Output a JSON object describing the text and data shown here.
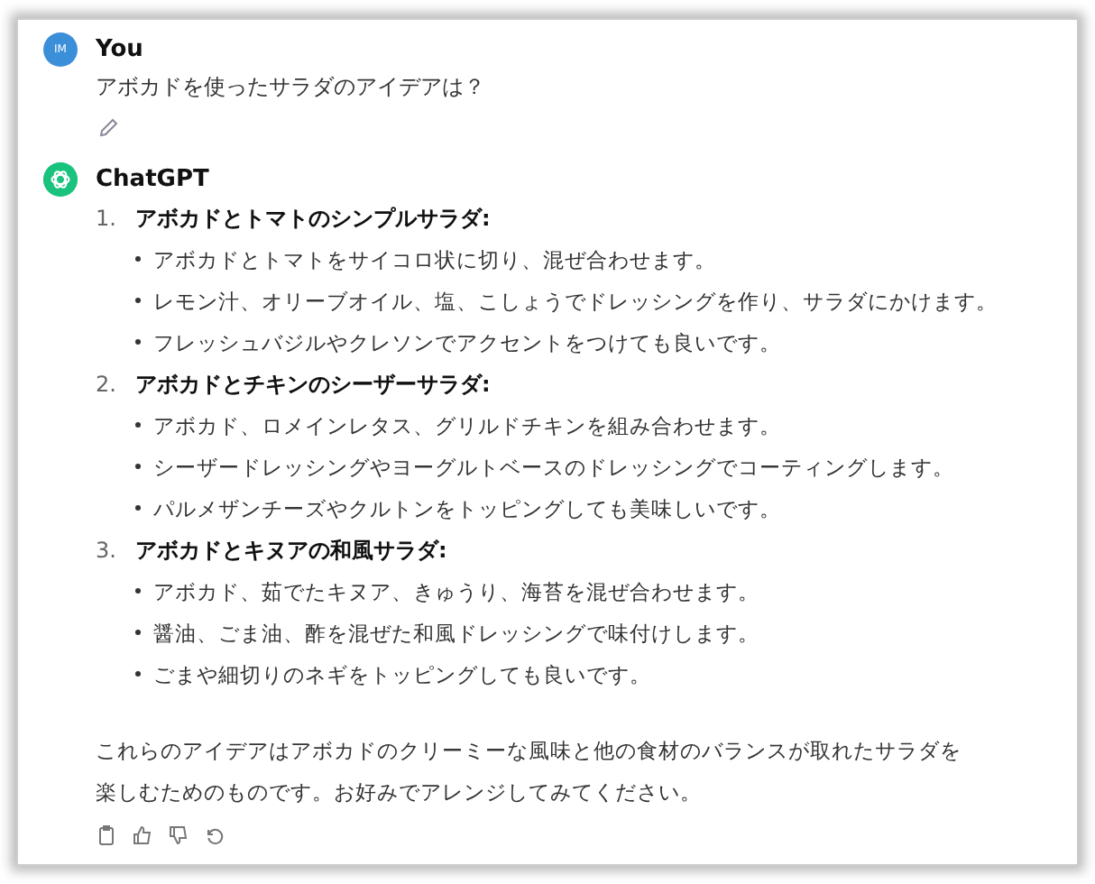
{
  "user": {
    "avatar": "IM",
    "name": "You",
    "message": "アボカドを使ったサラダのアイデアは？"
  },
  "assistant": {
    "name": "ChatGPT",
    "items": [
      {
        "number": "1.",
        "title": "アボカドとトマトのシンプルサラダ:",
        "bullets": [
          "アボカドとトマトをサイコロ状に切り、混ぜ合わせます。",
          "レモン汁、オリーブオイル、塩、こしょうでドレッシングを作り、サラダにかけます。",
          "フレッシュバジルやクレソンでアクセントをつけても良いです。"
        ]
      },
      {
        "number": "2.",
        "title": "アボカドとチキンのシーザーサラダ:",
        "bullets": [
          "アボカド、ロメインレタス、グリルドチキンを組み合わせます。",
          "シーザードレッシングやヨーグルトベースのドレッシングでコーティングします。",
          "パルメザンチーズやクルトンをトッピングしても美味しいです。"
        ]
      },
      {
        "number": "3.",
        "title": "アボカドとキヌアの和風サラダ:",
        "bullets": [
          "アボカド、茹でたキヌア、きゅうり、海苔を混ぜ合わせます。",
          "醤油、ごま油、酢を混ぜた和風ドレッシングで味付けします。",
          "ごまや細切りのネギをトッピングしても良いです。"
        ]
      }
    ],
    "closing": "これらのアイデアはアボカドのクリーミーな風味と他の食材のバランスが取れたサラダを楽しむためのものです。お好みでアレンジしてみてください。"
  }
}
